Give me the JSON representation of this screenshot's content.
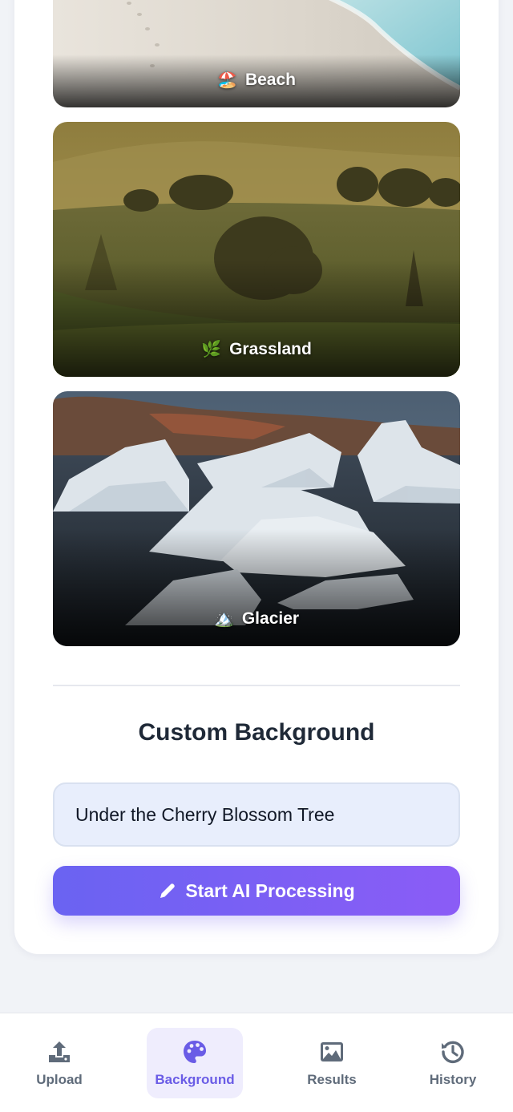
{
  "backgrounds": [
    {
      "label": "Beach",
      "emoji": "🏖️"
    },
    {
      "label": "Grassland",
      "emoji": "🌿"
    },
    {
      "label": "Glacier",
      "emoji": "🏔️"
    }
  ],
  "custom": {
    "title": "Custom Background",
    "input_value": "Under the Cherry Blossom Tree"
  },
  "start_button": {
    "label": "Start AI Processing",
    "icon": "pencil-icon"
  },
  "nav": {
    "items": [
      {
        "label": "Upload",
        "icon": "upload-icon"
      },
      {
        "label": "Background",
        "icon": "palette-icon",
        "active": true
      },
      {
        "label": "Results",
        "icon": "image-icon"
      },
      {
        "label": "History",
        "icon": "history-icon"
      }
    ]
  },
  "colors": {
    "accent": "#6a5ce6",
    "button_gradient_start": "#6a63f2",
    "button_gradient_end": "#8b5cf6",
    "nav_inactive": "#5f6b7a"
  }
}
